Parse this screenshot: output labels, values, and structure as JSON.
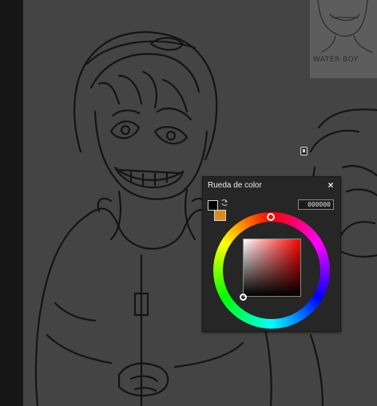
{
  "color_wheel": {
    "title": "Rueda de color",
    "close_label": "×",
    "hex_value": "000000",
    "foreground_color": "#000000",
    "background_color": "#e08a18",
    "hue_degrees": 0
  },
  "thumbnail": {
    "label": "WATER BOY"
  },
  "colors": {
    "canvas_bg": "#444444",
    "panel_bg": "#262626",
    "sidebar_bg": "#171717"
  }
}
